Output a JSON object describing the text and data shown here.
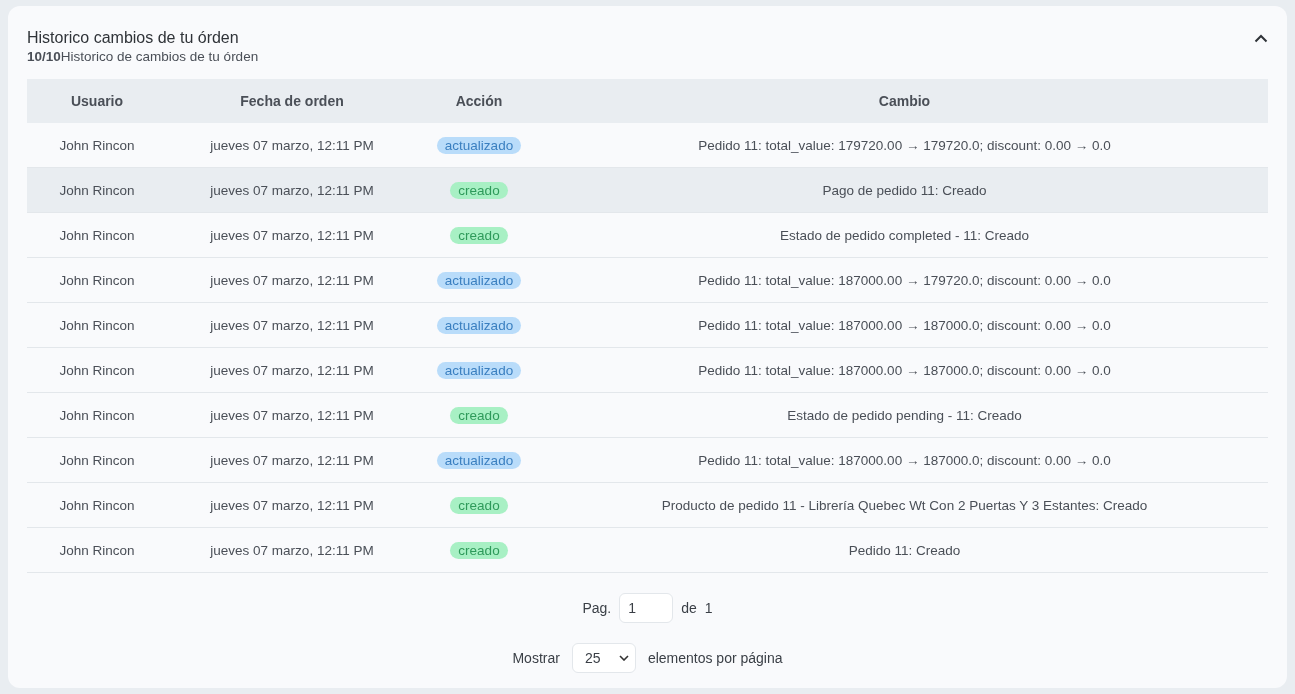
{
  "panel": {
    "title": "Historico cambios de tu órden",
    "subtitle": "**10/10**Historico de cambios de tu órden",
    "expanded": true
  },
  "table": {
    "columns": [
      "Usuario",
      "Fecha de orden",
      "Acción",
      "Cambio"
    ],
    "rows": [
      {
        "user": "John Rincon",
        "date": "jueves 07 marzo, 12:11 PM",
        "action": {
          "label": "actualizado",
          "kind": "updated"
        },
        "change": "Pedido 11: total_value: 179720.00 → 179720.0; discount: 0.00 → 0.0",
        "selected": false
      },
      {
        "user": "John Rincon",
        "date": "jueves 07 marzo, 12:11 PM",
        "action": {
          "label": "creado",
          "kind": "created"
        },
        "change": "Pago de pedido 11: Creado",
        "selected": true
      },
      {
        "user": "John Rincon",
        "date": "jueves 07 marzo, 12:11 PM",
        "action": {
          "label": "creado",
          "kind": "created"
        },
        "change": "Estado de pedido completed - 11: Creado",
        "selected": false
      },
      {
        "user": "John Rincon",
        "date": "jueves 07 marzo, 12:11 PM",
        "action": {
          "label": "actualizado",
          "kind": "updated"
        },
        "change": "Pedido 11: total_value: 187000.00 → 179720.0; discount: 0.00 → 0.0",
        "selected": false
      },
      {
        "user": "John Rincon",
        "date": "jueves 07 marzo, 12:11 PM",
        "action": {
          "label": "actualizado",
          "kind": "updated"
        },
        "change": "Pedido 11: total_value: 187000.00 → 187000.0; discount: 0.00 → 0.0",
        "selected": false
      },
      {
        "user": "John Rincon",
        "date": "jueves 07 marzo, 12:11 PM",
        "action": {
          "label": "actualizado",
          "kind": "updated"
        },
        "change": "Pedido 11: total_value: 187000.00 → 187000.0; discount: 0.00 → 0.0",
        "selected": false
      },
      {
        "user": "John Rincon",
        "date": "jueves 07 marzo, 12:11 PM",
        "action": {
          "label": "creado",
          "kind": "created"
        },
        "change": "Estado de pedido pending - 11: Creado",
        "selected": false
      },
      {
        "user": "John Rincon",
        "date": "jueves 07 marzo, 12:11 PM",
        "action": {
          "label": "actualizado",
          "kind": "updated"
        },
        "change": "Pedido 11: total_value: 187000.00 → 187000.0; discount: 0.00 → 0.0",
        "selected": false
      },
      {
        "user": "John Rincon",
        "date": "jueves 07 marzo, 12:11 PM",
        "action": {
          "label": "creado",
          "kind": "created"
        },
        "change": "Producto de pedido 11 - Librería Quebec Wt Con 2 Puertas Y 3 Estantes: Creado",
        "selected": false
      },
      {
        "user": "John Rincon",
        "date": "jueves 07 marzo, 12:11 PM",
        "action": {
          "label": "creado",
          "kind": "created"
        },
        "change": "Pedido 11: Creado",
        "selected": false
      }
    ]
  },
  "pagination": {
    "page_label": "Pag.",
    "page_value": "1",
    "of_label": "de",
    "total_pages": "1",
    "show_label": "Mostrar",
    "page_size": "25",
    "per_page_label": "elementos por página"
  }
}
